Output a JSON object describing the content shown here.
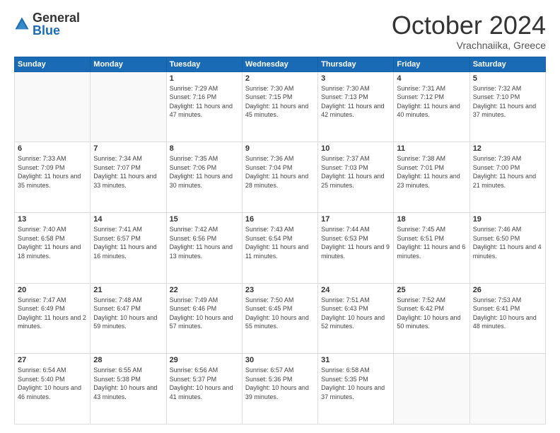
{
  "logo": {
    "general": "General",
    "blue": "Blue"
  },
  "header": {
    "month": "October 2024",
    "location": "Vrachnaiika, Greece"
  },
  "weekdays": [
    "Sunday",
    "Monday",
    "Tuesday",
    "Wednesday",
    "Thursday",
    "Friday",
    "Saturday"
  ],
  "weeks": [
    [
      {
        "day": "",
        "info": ""
      },
      {
        "day": "",
        "info": ""
      },
      {
        "day": "1",
        "info": "Sunrise: 7:29 AM\nSunset: 7:16 PM\nDaylight: 11 hours and 47 minutes."
      },
      {
        "day": "2",
        "info": "Sunrise: 7:30 AM\nSunset: 7:15 PM\nDaylight: 11 hours and 45 minutes."
      },
      {
        "day": "3",
        "info": "Sunrise: 7:30 AM\nSunset: 7:13 PM\nDaylight: 11 hours and 42 minutes."
      },
      {
        "day": "4",
        "info": "Sunrise: 7:31 AM\nSunset: 7:12 PM\nDaylight: 11 hours and 40 minutes."
      },
      {
        "day": "5",
        "info": "Sunrise: 7:32 AM\nSunset: 7:10 PM\nDaylight: 11 hours and 37 minutes."
      }
    ],
    [
      {
        "day": "6",
        "info": "Sunrise: 7:33 AM\nSunset: 7:09 PM\nDaylight: 11 hours and 35 minutes."
      },
      {
        "day": "7",
        "info": "Sunrise: 7:34 AM\nSunset: 7:07 PM\nDaylight: 11 hours and 33 minutes."
      },
      {
        "day": "8",
        "info": "Sunrise: 7:35 AM\nSunset: 7:06 PM\nDaylight: 11 hours and 30 minutes."
      },
      {
        "day": "9",
        "info": "Sunrise: 7:36 AM\nSunset: 7:04 PM\nDaylight: 11 hours and 28 minutes."
      },
      {
        "day": "10",
        "info": "Sunrise: 7:37 AM\nSunset: 7:03 PM\nDaylight: 11 hours and 25 minutes."
      },
      {
        "day": "11",
        "info": "Sunrise: 7:38 AM\nSunset: 7:01 PM\nDaylight: 11 hours and 23 minutes."
      },
      {
        "day": "12",
        "info": "Sunrise: 7:39 AM\nSunset: 7:00 PM\nDaylight: 11 hours and 21 minutes."
      }
    ],
    [
      {
        "day": "13",
        "info": "Sunrise: 7:40 AM\nSunset: 6:58 PM\nDaylight: 11 hours and 18 minutes."
      },
      {
        "day": "14",
        "info": "Sunrise: 7:41 AM\nSunset: 6:57 PM\nDaylight: 11 hours and 16 minutes."
      },
      {
        "day": "15",
        "info": "Sunrise: 7:42 AM\nSunset: 6:56 PM\nDaylight: 11 hours and 13 minutes."
      },
      {
        "day": "16",
        "info": "Sunrise: 7:43 AM\nSunset: 6:54 PM\nDaylight: 11 hours and 11 minutes."
      },
      {
        "day": "17",
        "info": "Sunrise: 7:44 AM\nSunset: 6:53 PM\nDaylight: 11 hours and 9 minutes."
      },
      {
        "day": "18",
        "info": "Sunrise: 7:45 AM\nSunset: 6:51 PM\nDaylight: 11 hours and 6 minutes."
      },
      {
        "day": "19",
        "info": "Sunrise: 7:46 AM\nSunset: 6:50 PM\nDaylight: 11 hours and 4 minutes."
      }
    ],
    [
      {
        "day": "20",
        "info": "Sunrise: 7:47 AM\nSunset: 6:49 PM\nDaylight: 11 hours and 2 minutes."
      },
      {
        "day": "21",
        "info": "Sunrise: 7:48 AM\nSunset: 6:47 PM\nDaylight: 10 hours and 59 minutes."
      },
      {
        "day": "22",
        "info": "Sunrise: 7:49 AM\nSunset: 6:46 PM\nDaylight: 10 hours and 57 minutes."
      },
      {
        "day": "23",
        "info": "Sunrise: 7:50 AM\nSunset: 6:45 PM\nDaylight: 10 hours and 55 minutes."
      },
      {
        "day": "24",
        "info": "Sunrise: 7:51 AM\nSunset: 6:43 PM\nDaylight: 10 hours and 52 minutes."
      },
      {
        "day": "25",
        "info": "Sunrise: 7:52 AM\nSunset: 6:42 PM\nDaylight: 10 hours and 50 minutes."
      },
      {
        "day": "26",
        "info": "Sunrise: 7:53 AM\nSunset: 6:41 PM\nDaylight: 10 hours and 48 minutes."
      }
    ],
    [
      {
        "day": "27",
        "info": "Sunrise: 6:54 AM\nSunset: 5:40 PM\nDaylight: 10 hours and 46 minutes."
      },
      {
        "day": "28",
        "info": "Sunrise: 6:55 AM\nSunset: 5:38 PM\nDaylight: 10 hours and 43 minutes."
      },
      {
        "day": "29",
        "info": "Sunrise: 6:56 AM\nSunset: 5:37 PM\nDaylight: 10 hours and 41 minutes."
      },
      {
        "day": "30",
        "info": "Sunrise: 6:57 AM\nSunset: 5:36 PM\nDaylight: 10 hours and 39 minutes."
      },
      {
        "day": "31",
        "info": "Sunrise: 6:58 AM\nSunset: 5:35 PM\nDaylight: 10 hours and 37 minutes."
      },
      {
        "day": "",
        "info": ""
      },
      {
        "day": "",
        "info": ""
      }
    ]
  ]
}
